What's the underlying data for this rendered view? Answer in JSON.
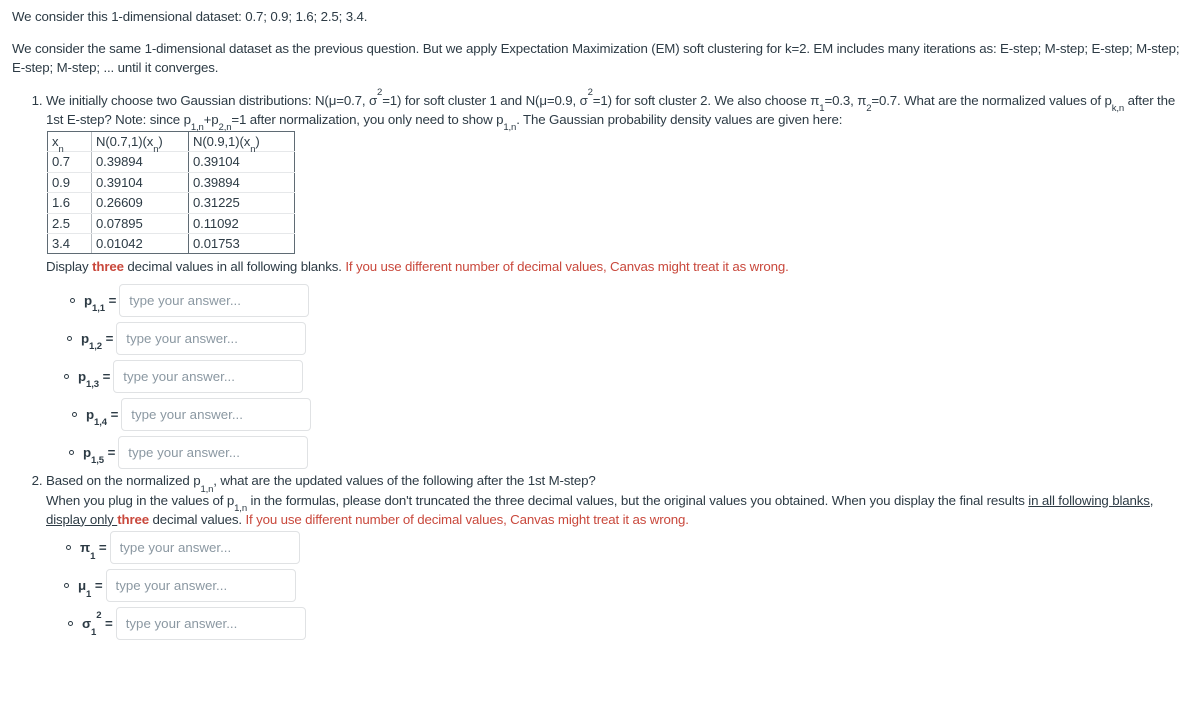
{
  "intro": {
    "line1": "We consider this 1-dimensional dataset: 0.7; 0.9; 1.6; 2.5; 3.4.",
    "line2": "We consider the same 1-dimensional dataset as the previous question. But we apply Expectation Maximization (EM) soft clustering for k=2. EM includes many iterations as: E-step; M-step; E-step; M-step; E-step; M-step; ... until it converges."
  },
  "question1": {
    "part_a": "We initially choose two Gaussian distributions: N(μ=0.7, σ",
    "part_a_sup": "2",
    "part_b": "=1) for soft cluster 1 and N(μ=0.9, σ",
    "part_b_sup": "2",
    "part_c": "=1) for soft cluster 2. We also choose π",
    "pi1_sub": "1",
    "part_d": "=0.3, π",
    "pi2_sub": "2",
    "part_e": "=0.7. What are the normalized values of p",
    "pkn_sub": "k,n",
    "part_f": " after the 1st E-step? Note: since p",
    "p1n_sub_a": "1,n",
    "part_g": "+p",
    "p2n_sub": "2,n",
    "part_h": "=1 after normalization, you only need to show p",
    "p1n_sub_b": "1,n",
    "part_i": ". The Gaussian probability density values are given here:"
  },
  "table": {
    "headers": [
      "xₙ",
      "N(0.7,1)(xₙ)",
      "N(0.9,1)(xₙ)"
    ],
    "header_cells": [
      {
        "base": "x",
        "sub": "n"
      },
      {
        "base": "N(0.7,1)(x",
        "sub": "n",
        "tail": ")"
      },
      {
        "base": "N(0.9,1)(x",
        "sub": "n",
        "tail": ")"
      }
    ],
    "rows": [
      [
        "0.7",
        "0.39894",
        "0.39104"
      ],
      [
        "0.9",
        "0.39104",
        "0.39894"
      ],
      [
        "1.6",
        "0.26609",
        "0.31225"
      ],
      [
        "2.5",
        "0.07895",
        "0.11092"
      ],
      [
        "3.4",
        "0.01042",
        "0.01753"
      ]
    ]
  },
  "display_note": {
    "lead": "Display ",
    "emphasis": "three",
    "mid": " decimal values in all following blanks. ",
    "warning": "If you use different number of decimal values, Canvas might treat it as wrong."
  },
  "blanks_q1": [
    {
      "label_base": "p",
      "label_sub": "1,1",
      "equals": " =",
      "placeholder": "type your answer...",
      "value": ""
    },
    {
      "label_base": "p",
      "label_sub": "1,2",
      "equals": " =",
      "placeholder": "type your answer...",
      "value": ""
    },
    {
      "label_base": "p",
      "label_sub": "1,3",
      "equals": " =",
      "placeholder": "type your answer...",
      "value": ""
    },
    {
      "label_base": "p",
      "label_sub": "1,4",
      "equals": " =",
      "placeholder": "type your answer...",
      "value": ""
    },
    {
      "label_base": "p",
      "label_sub": "1,5",
      "equals": " =",
      "placeholder": "type your answer...",
      "value": ""
    }
  ],
  "question2": {
    "part_a": "Based on the normalized p",
    "p1n_sub_a": "1,n",
    "part_b": ", what are the updated values of the following after the 1st M-step?",
    "part_c": "When you plug in the values of p",
    "p1n_sub_b": "1,n",
    "part_d": " in the formulas, please don't truncated the three decimal values, but the original values you obtained. When you display the final results ",
    "underlined": "in all following blanks, display only ",
    "emphasis": "three",
    "part_e": " decimal values. ",
    "warning": "If you use different number of decimal values, Canvas might treat it as wrong."
  },
  "blanks_q2": [
    {
      "label_base": "π",
      "label_sub": "1",
      "equals": " =",
      "placeholder": "type your answer...",
      "value": ""
    },
    {
      "label_base": "μ",
      "label_sub": "1",
      "equals": " =",
      "placeholder": "type your answer...",
      "value": ""
    },
    {
      "label_base": "σ",
      "label_sub": "1",
      "label_sup": "2",
      "equals": " =",
      "placeholder": "type your answer...",
      "value": ""
    }
  ],
  "colors": {
    "text": "#2d3b45",
    "warning_red": "#c9483c",
    "input_border": "#e0e2e4",
    "placeholder": "#8b98a2"
  }
}
